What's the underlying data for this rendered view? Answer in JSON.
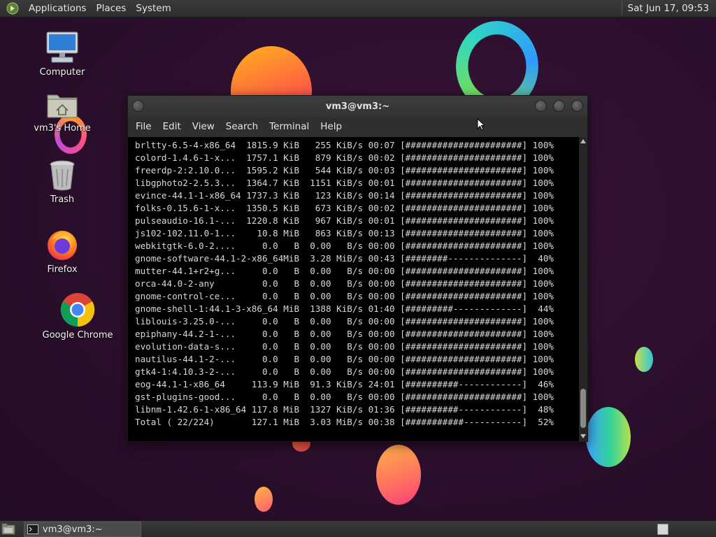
{
  "top_panel": {
    "menus": [
      "Applications",
      "Places",
      "System"
    ],
    "clock": "Sat Jun 17, 09:53"
  },
  "desktop_icons": {
    "computer": "Computer",
    "home": "vm3's Home",
    "trash": "Trash",
    "firefox": "Firefox",
    "chrome": "Google Chrome"
  },
  "terminal": {
    "title": "vm3@vm3:~",
    "menu": [
      "File",
      "Edit",
      "View",
      "Search",
      "Terminal",
      "Help"
    ],
    "lines": [
      "brltty-6.5-4-x86_64  1815.9 KiB   255 KiB/s 00:07 [######################] 100%",
      "colord-1.4.6-1-x...  1757.1 KiB   879 KiB/s 00:02 [######################] 100%",
      "freerdp-2:2.10.0...  1595.2 KiB   544 KiB/s 00:03 [######################] 100%",
      "libgphoto2-2.5.3...  1364.7 KiB  1151 KiB/s 00:01 [######################] 100%",
      "evince-44.1-1-x86_64 1737.3 KiB   123 KiB/s 00:14 [######################] 100%",
      "folks-0.15.6-1-x...  1350.5 KiB   673 KiB/s 00:02 [######################] 100%",
      "pulseaudio-16.1-...  1220.8 KiB   967 KiB/s 00:01 [######################] 100%",
      "js102-102.11.0-1...    10.8 MiB   863 KiB/s 00:13 [######################] 100%",
      "webkitgtk-6.0-2....     0.0   B  0.00   B/s 00:00 [######################] 100%",
      "gnome-software-44.1-2-x86_64MiB  3.28 MiB/s 00:43 [########--------------]  40%",
      "mutter-44.1+r2+g...     0.0   B  0.00   B/s 00:00 [######################] 100%",
      "orca-44.0-2-any         0.0   B  0.00   B/s 00:00 [######################] 100%",
      "gnome-control-ce...     0.0   B  0.00   B/s 00:00 [######################] 100%",
      "gnome-shell-1:44.1-3-x86_64 MiB  1388 KiB/s 01:40 [#########-------------]  44%",
      "liblouis-3.25.0-...     0.0   B  0.00   B/s 00:00 [######################] 100%",
      "epiphany-44.2-1-...     0.0   B  0.00   B/s 00:00 [######################] 100%",
      "evolution-data-s...     0.0   B  0.00   B/s 00:00 [######################] 100%",
      "nautilus-44.1-2-...     0.0   B  0.00   B/s 00:00 [######################] 100%",
      "gtk4-1:4.10.3-2-...     0.0   B  0.00   B/s 00:00 [######################] 100%",
      "eog-44.1-1-x86_64     113.9 MiB  91.3 KiB/s 24:01 [##########------------]  46%",
      "gst-plugins-good...     0.0   B  0.00   B/s 00:00 [######################] 100%",
      "libnm-1.42.6-1-x86_64 117.8 MiB  1327 KiB/s 01:36 [##########------------]  48%",
      "Total ( 22/224)       127.1 MiB  3.03 MiB/s 00:38 [###########-----------]  52%"
    ]
  },
  "bottom_panel": {
    "task_label": "vm3@vm3:~"
  },
  "icons": {
    "menu_logo": "foot-logo-icon",
    "computer": "computer-icon",
    "home": "home-folder-icon",
    "trash": "trash-icon",
    "firefox": "firefox-icon",
    "chrome": "chrome-icon",
    "terminal_task": "terminal-icon",
    "show_desktop": "show-desktop-icon",
    "workspace": "workspace-switcher-icon"
  },
  "colors": {
    "desktop_bg": "#2a0f2c",
    "panel_bg": "#333333",
    "terminal_bg": "#000000",
    "terminal_fg": "#d8d8d8"
  }
}
